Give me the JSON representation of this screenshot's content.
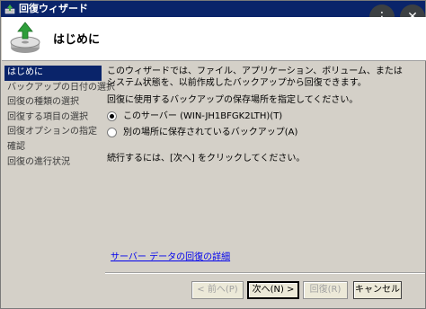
{
  "window": {
    "title": "回復ウィザード"
  },
  "overlay": {
    "more_glyph": "⋮",
    "close_glyph": "✕"
  },
  "header": {
    "title": "はじめに"
  },
  "sidebar": {
    "items": [
      {
        "label": "はじめに",
        "active": true
      },
      {
        "label": "バックアップの日付の選択"
      },
      {
        "label": "回復の種類の選択"
      },
      {
        "label": "回復する項目の選択"
      },
      {
        "label": "回復オプションの指定"
      },
      {
        "label": "確認"
      },
      {
        "label": "回復の進行状況"
      }
    ]
  },
  "content": {
    "intro": "このウィザードでは、ファイル、アプリケーション、ボリューム、またはシステム状態を、以前作成したバックアップから回復できます。",
    "prompt": "回復に使用するバックアップの保存場所を指定してください。",
    "options": [
      {
        "label": "このサーバー (WIN-JH1BFGK2LTH)(T)",
        "checked": true
      },
      {
        "label": "別の場所に保存されているバックアップ(A)",
        "checked": false
      }
    ],
    "continue_text": "続行するには、[次へ] をクリックしてください。",
    "link": "サーバー データの回復の詳細"
  },
  "buttons": {
    "back": "< 前へ(P)",
    "next": "次へ(N) >",
    "recover": "回復(R)",
    "cancel": "キャンセル"
  }
}
